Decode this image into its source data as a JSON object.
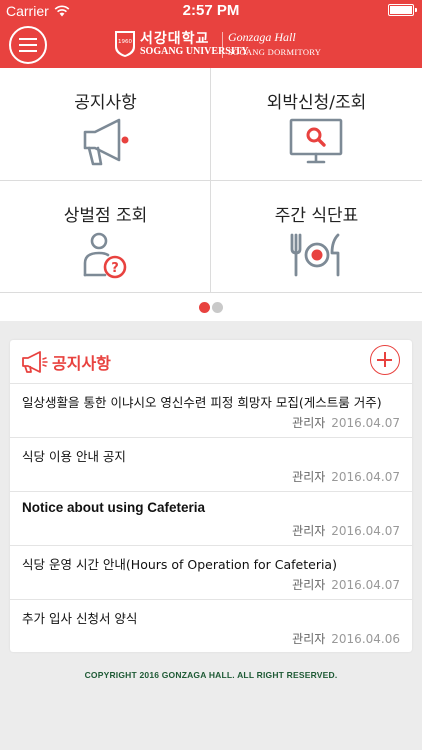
{
  "status_bar": {
    "carrier": "Carrier",
    "time": "2:57 PM"
  },
  "header": {
    "university_kr": "서강대학교",
    "university_en": "SOGANG UNIVERSITY",
    "hall_name": "Gonzaga Hall",
    "hall_subtitle": "SOGANG DORMITORY",
    "emblem_text": "1960"
  },
  "menu": [
    {
      "label": "공지사항",
      "icon": "megaphone-icon"
    },
    {
      "label": "외박신청/조회",
      "icon": "monitor-search-icon"
    },
    {
      "label": "상벌점 조회",
      "icon": "user-question-icon"
    },
    {
      "label": "주간 식단표",
      "icon": "meal-icon"
    }
  ],
  "pager": {
    "active_page": 1,
    "total_pages": 2
  },
  "notices": {
    "title": "공지사항",
    "items": [
      {
        "title": "일상생활을 통한 이냐시오 영신수련 피정 희망자 모집(게스트룸 거주)",
        "author": "관리자",
        "date": "2016.04.07"
      },
      {
        "title": "식당 이용 안내 공지",
        "author": "관리자",
        "date": "2016.04.07"
      },
      {
        "title": "Notice about using Cafeteria",
        "author": "관리자",
        "date": "2016.04.07"
      },
      {
        "title": "식당 운영 시간 안내(Hours of Operation for Cafeteria)",
        "author": "관리자",
        "date": "2016.04.07"
      },
      {
        "title": "추가 입사 신청서 양식",
        "author": "관리자",
        "date": "2016.04.06"
      }
    ]
  },
  "footer": {
    "copyright": "COPYRIGHT 2016 GONZAGA HALL. ALL RIGHT RESERVED."
  },
  "colors": {
    "brand": "#e8423f",
    "icon_gray": "#7d8a96",
    "copyright_green": "#1e5a35"
  }
}
